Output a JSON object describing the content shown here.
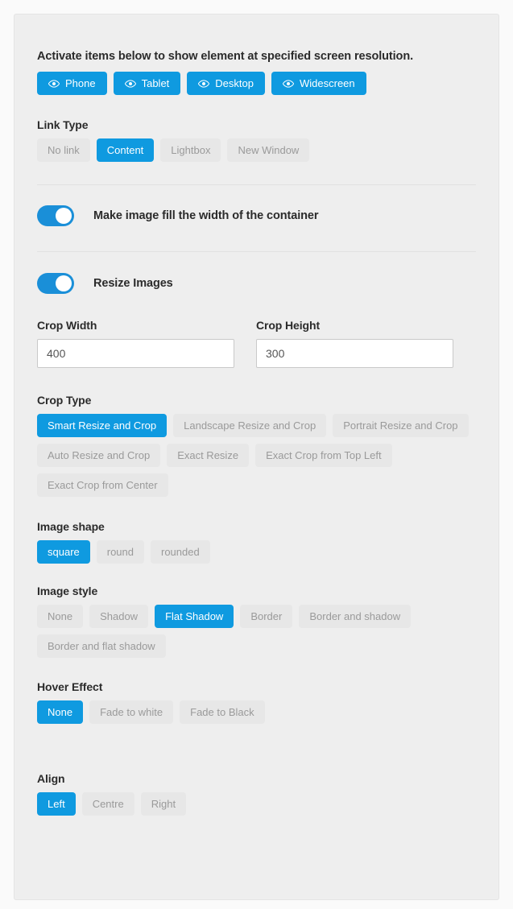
{
  "intro": {
    "text": "Activate items below to show element at specified screen resolution."
  },
  "colors": {
    "accent": "#0f9ae0",
    "toggle_on": "#1a8fd8",
    "pill_bg": "#e7e7e7",
    "pill_text": "#9a9a9a",
    "panel_bg": "#eeeeee",
    "page_bg": "#fafafa"
  },
  "devices": {
    "icon": "eye-icon",
    "items": [
      {
        "label": "Phone",
        "active": true
      },
      {
        "label": "Tablet",
        "active": true
      },
      {
        "label": "Desktop",
        "active": true
      },
      {
        "label": "Widescreen",
        "active": true
      }
    ]
  },
  "link_type": {
    "label": "Link Type",
    "selected": "Content",
    "options": [
      {
        "label": "No link",
        "active": false
      },
      {
        "label": "Content",
        "active": true
      },
      {
        "label": "Lightbox",
        "active": false
      },
      {
        "label": "New Window",
        "active": false
      }
    ]
  },
  "fill_width": {
    "label": "Make image fill the width of the container",
    "enabled": true
  },
  "resize_images": {
    "label": "Resize Images",
    "enabled": true
  },
  "crop_width": {
    "label": "Crop Width",
    "value": "400",
    "placeholder": ""
  },
  "crop_height": {
    "label": "Crop Height",
    "value": "300",
    "placeholder": ""
  },
  "crop_type": {
    "label": "Crop Type",
    "selected": "Smart Resize and Crop",
    "options": [
      {
        "label": "Smart Resize and Crop",
        "active": true
      },
      {
        "label": "Landscape Resize and Crop",
        "active": false
      },
      {
        "label": "Portrait Resize and Crop",
        "active": false
      },
      {
        "label": "Auto Resize and Crop",
        "active": false
      },
      {
        "label": "Exact Resize",
        "active": false
      },
      {
        "label": "Exact Crop from Top Left",
        "active": false
      },
      {
        "label": "Exact Crop from Center",
        "active": false
      }
    ]
  },
  "image_shape": {
    "label": "Image shape",
    "selected": "square",
    "options": [
      {
        "label": "square",
        "active": true
      },
      {
        "label": "round",
        "active": false
      },
      {
        "label": "rounded",
        "active": false
      }
    ]
  },
  "image_style": {
    "label": "Image style",
    "selected": "Flat Shadow",
    "options": [
      {
        "label": "None",
        "active": false
      },
      {
        "label": "Shadow",
        "active": false
      },
      {
        "label": "Flat Shadow",
        "active": true
      },
      {
        "label": "Border",
        "active": false
      },
      {
        "label": "Border and shadow",
        "active": false
      },
      {
        "label": "Border and flat shadow",
        "active": false
      }
    ]
  },
  "hover_effect": {
    "label": "Hover Effect",
    "selected": "None",
    "options": [
      {
        "label": "None",
        "active": true
      },
      {
        "label": "Fade to white",
        "active": false
      },
      {
        "label": "Fade to Black",
        "active": false
      }
    ]
  },
  "align": {
    "label": "Align",
    "selected": "Left",
    "options": [
      {
        "label": "Left",
        "active": true
      },
      {
        "label": "Centre",
        "active": false
      },
      {
        "label": "Right",
        "active": false
      }
    ]
  }
}
